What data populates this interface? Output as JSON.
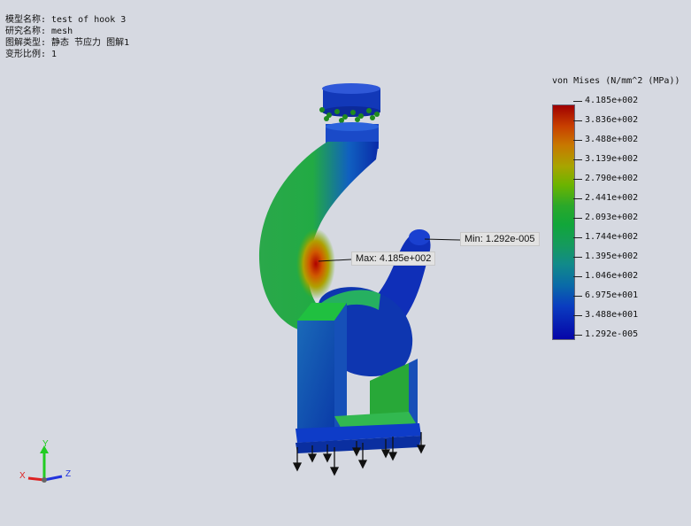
{
  "study_info": {
    "model_name": "模型名称: test of hook 3",
    "study_name": "研究名称: mesh",
    "plot_type": "图解类型: 静态 节应力 图解1",
    "deformation_scale": "变形比例: 1"
  },
  "legend": {
    "title": "von Mises (N/mm^2 (MPa))",
    "ticks": [
      "4.185e+002",
      "3.836e+002",
      "3.488e+002",
      "3.139e+002",
      "2.790e+002",
      "2.441e+002",
      "2.093e+002",
      "1.744e+002",
      "1.395e+002",
      "1.046e+002",
      "6.975e+001",
      "3.488e+001",
      "1.292e-005"
    ]
  },
  "callouts": {
    "max": "Max: 4.185e+002",
    "min": "Min: 1.292e-005"
  },
  "triad": {
    "x": "X",
    "y": "Y",
    "z": "Z"
  }
}
